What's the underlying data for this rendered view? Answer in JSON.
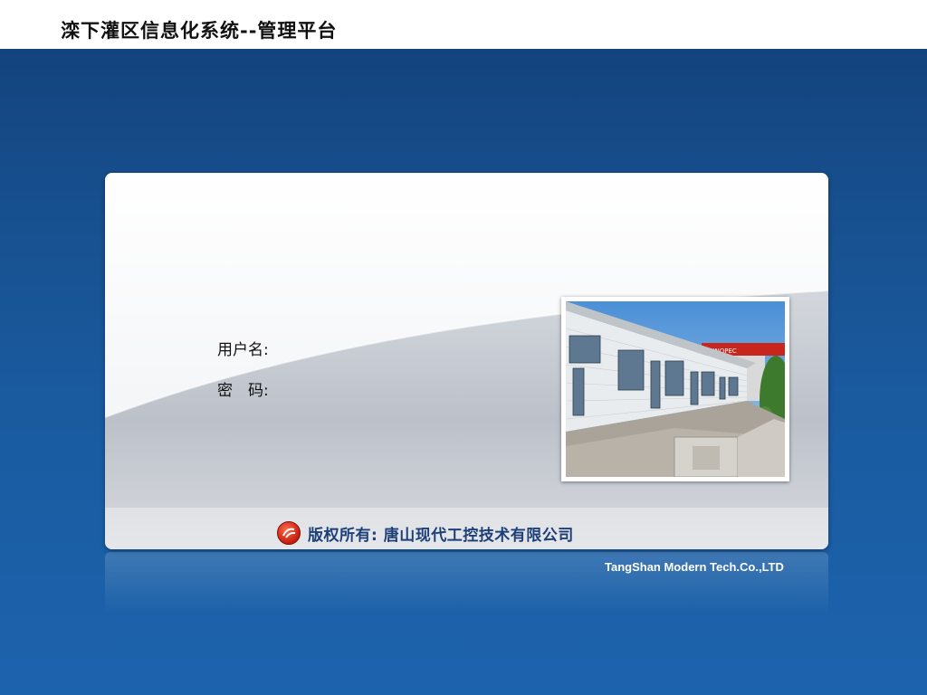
{
  "header": {
    "title": "滦下灌区信息化系统--管理平台"
  },
  "login": {
    "username_label": "用户名:",
    "username_value": "",
    "password_label": "密　码:",
    "password_value": ""
  },
  "photo": {
    "sign_text": "SINOPEC"
  },
  "copyright": {
    "text": "版权所有: 唐山现代工控技术有限公司"
  },
  "footer": {
    "company_en": "TangShan Modern Tech.Co.,LTD"
  },
  "colors": {
    "background_top": "#123f78",
    "background_bottom": "#1c63ad",
    "copyright_text": "#1d3f78",
    "logo_red": "#c41d10"
  }
}
